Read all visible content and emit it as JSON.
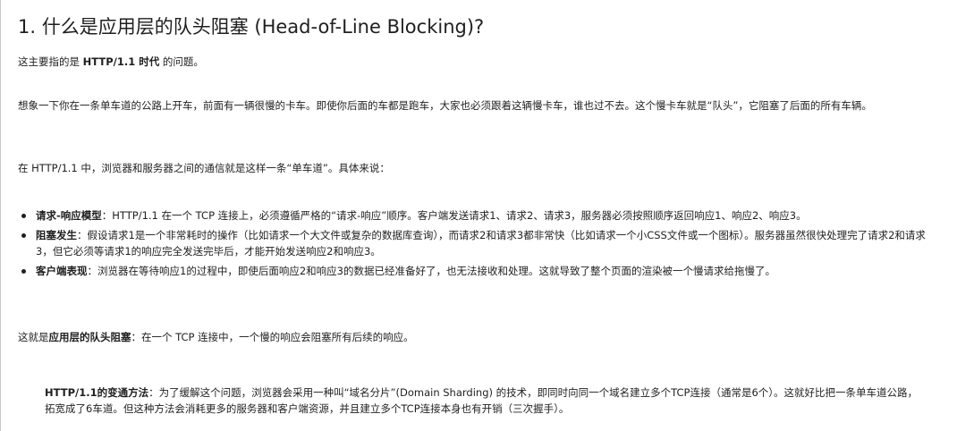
{
  "heading": "1. 什么是应用层的队头阻塞 (Head-of-Line Blocking)?",
  "intro": {
    "prefix": "这主要指的是 ",
    "bold": "HTTP/1.1 时代",
    "suffix": " 的问题。"
  },
  "analogy": "想象一下你在一条单车道的公路上开车，前面有一辆很慢的卡车。即使你后面的车都是跑车，大家也必须跟着这辆慢卡车，谁也过不去。这个慢卡车就是“队头”，它阻塞了后面的所有车辆。",
  "context": "在 HTTP/1.1 中，浏览器和服务器之间的通信就是这样一条“单车道”。具体来说：",
  "bullets": [
    {
      "title": "请求-响应模型",
      "text": "：HTTP/1.1 在一个 TCP 连接上，必须遵循严格的“请求-响应”顺序。客户端发送请求1、请求2、请求3，服务器必须按照顺序返回响应1、响应2、响应3。"
    },
    {
      "title": "阻塞发生",
      "text": "：假设请求1是一个非常耗时的操作（比如请求一个大文件或复杂的数据库查询），而请求2和请求3都非常快（比如请求一个小CSS文件或一个图标）。服务器虽然很快处理完了请求2和请求3，但它必须等请求1的响应完全发送完毕后，才能开始发送响应2和响应3。"
    },
    {
      "title": "客户端表现",
      "text": "：浏览器在等待响应1的过程中，即使后面响应2和响应3的数据已经准备好了，也无法接收和处理。这就导致了整个页面的渲染被一个慢请求给拖慢了。"
    }
  ],
  "summary": {
    "prefix": "这就是",
    "bold": "应用层的队头阻塞",
    "suffix": "：在一个 TCP 连接中，一个慢的响应会阻塞所有后续的响应。"
  },
  "workaround": {
    "bold": "HTTP/1.1的变通方法",
    "text": "：为了缓解这个问题，浏览器会采用一种叫“域名分片”(Domain Sharding) 的技术，即同时向同一个域名建立多个TCP连接（通常是6个）。这就好比把一条单车道公路，拓宽成了6车道。但这种方法会消耗更多的服务器和客户端资源，并且建立多个TCP连接本身也有开销（三次握手）。"
  }
}
